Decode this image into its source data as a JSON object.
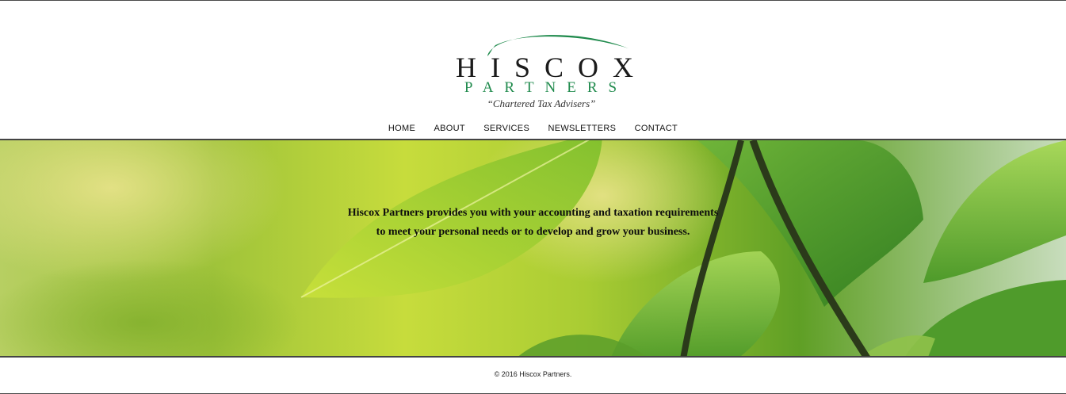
{
  "brand": {
    "name_line1": "HISCOX",
    "name_line2": "PARTNERS",
    "tagline": "“Chartered Tax Advisers”",
    "accent_color": "#1f8a4c"
  },
  "nav": {
    "items": [
      {
        "label": "HOME"
      },
      {
        "label": "ABOUT"
      },
      {
        "label": "SERVICES"
      },
      {
        "label": "NEWSLETTERS"
      },
      {
        "label": "CONTACT"
      }
    ]
  },
  "hero": {
    "line1": "Hiscox Partners provides you with your accounting and taxation requirements",
    "line2": "to meet your personal needs or to develop and grow your business."
  },
  "footer": {
    "copyright": "© 2016 Hiscox Partners."
  }
}
